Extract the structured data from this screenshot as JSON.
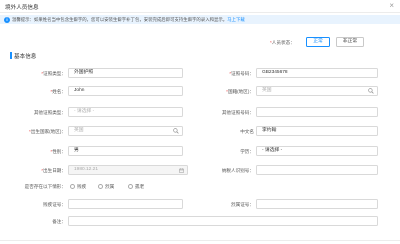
{
  "dialog": {
    "title": "境外人员信息",
    "close_symbol": "×"
  },
  "notice": {
    "icon": "info-icon",
    "text": "温馨提示：如果姓名当中包含生僻字的，您可以安装生僻字补丁包，安装完成后即可支持生僻字的录入和显示。",
    "link": "马上下载"
  },
  "status": {
    "label": "人员状态：",
    "options": [
      "正常",
      "非正常"
    ],
    "selected": "正常"
  },
  "section": {
    "title": "基本信息"
  },
  "form": {
    "id_type": {
      "label": "证照类型：",
      "value": "外国护照"
    },
    "id_number": {
      "label": "证照号码：",
      "value": "GB2345678"
    },
    "name": {
      "label": "姓名：",
      "value": "John"
    },
    "nationality": {
      "label": "国籍(地区)：",
      "placeholder": "英国"
    },
    "other_id_type": {
      "label": "其他证照类型：",
      "placeholder": "- 请选择 -"
    },
    "other_id_number": {
      "label": "其他证照号码：",
      "value": ""
    },
    "birth_country": {
      "label": "出生国家(地区)：",
      "placeholder": "英国"
    },
    "chinese_name": {
      "label": "中文名",
      "value": "李约翰"
    },
    "gender": {
      "label": "性别：",
      "value": "男"
    },
    "education": {
      "label": "学历：",
      "value": "- 请选择 -"
    },
    "birth_date": {
      "label": "出生日期：",
      "value": "1980.12.21"
    },
    "taxpayer_id": {
      "label": "纳税人识别号：",
      "value": ""
    },
    "has_china_id": {
      "label": "是否存在以下情形：",
      "options": [
        "残疾",
        "烈属",
        "孤老"
      ]
    },
    "disability_no": {
      "label": "残疾证号：",
      "value": ""
    },
    "martyr_no": {
      "label": "烈属证号：",
      "value": ""
    },
    "remark": {
      "label": "备注：",
      "value": ""
    }
  }
}
